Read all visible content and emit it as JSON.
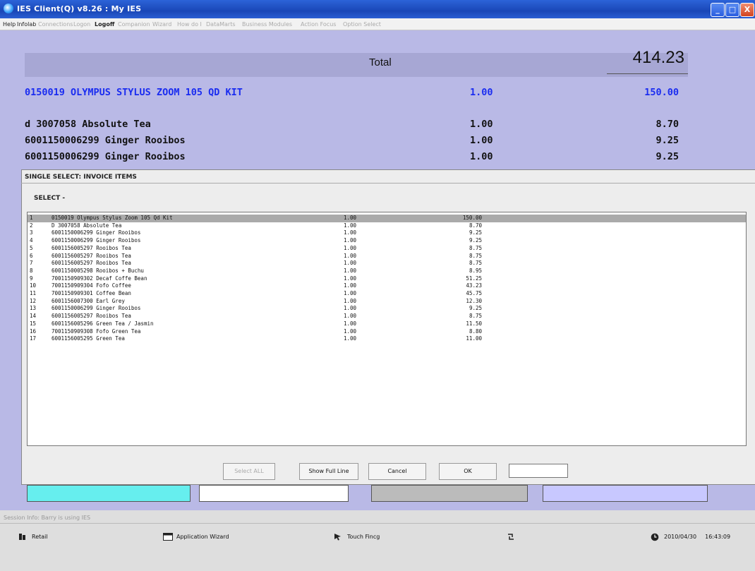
{
  "window": {
    "title": "IES Client(Q) v8.26 : My IES",
    "min": "_",
    "max": "□",
    "close": "X"
  },
  "menu": [
    {
      "label": "Help",
      "state": "on"
    },
    {
      "label": "Infolab",
      "state": "on"
    },
    {
      "label": "Connections",
      "state": "off"
    },
    {
      "label": "Logon",
      "state": "off"
    },
    {
      "label": "Logoff",
      "state": "bold"
    },
    {
      "label": "Companion",
      "state": "off"
    },
    {
      "label": "Wizard",
      "state": "off"
    },
    {
      "label": "How do I",
      "state": "off"
    },
    {
      "label": "DataMarts",
      "state": "off"
    },
    {
      "label": "Business Modules",
      "state": "off"
    },
    {
      "label": "Action Focus",
      "state": "off"
    },
    {
      "label": "Option Select",
      "state": "off"
    }
  ],
  "total": {
    "label": "Total",
    "value": "414.23"
  },
  "lines": [
    {
      "desc": "0150019 OLYMPUS STYLUS ZOOM 105 QD KIT",
      "qty": "1.00",
      "amt": "150.00",
      "highlight": true
    },
    {
      "desc": "d 3007058 Absolute Tea",
      "qty": "1.00",
      "amt": "8.70",
      "highlight": false
    },
    {
      "desc": "6001150006299 Ginger Rooibos",
      "qty": "1.00",
      "amt": "9.25",
      "highlight": false
    },
    {
      "desc": "6001150006299 Ginger Rooibos",
      "qty": "1.00",
      "amt": "9.25",
      "highlight": false
    }
  ],
  "dialog": {
    "title": "SINGLE SELECT: INVOICE ITEMS",
    "select_label": "SELECT -",
    "items": [
      {
        "no": "1",
        "desc": "0150019 Olympus Stylus Zoom 105 Qd Kit",
        "qty": "1.00",
        "amt": "150.00"
      },
      {
        "no": "2",
        "desc": "D 3007058 Absolute Tea",
        "qty": "1.00",
        "amt": "8.70"
      },
      {
        "no": "3",
        "desc": "6001150006299 Ginger Rooibos",
        "qty": "1.00",
        "amt": "9.25"
      },
      {
        "no": "4",
        "desc": "6001150006299 Ginger Rooibos",
        "qty": "1.00",
        "amt": "9.25"
      },
      {
        "no": "5",
        "desc": "6001156005297 Rooibos Tea",
        "qty": "1.00",
        "amt": "8.75"
      },
      {
        "no": "6",
        "desc": "6001156005297 Rooibos Tea",
        "qty": "1.00",
        "amt": "8.75"
      },
      {
        "no": "7",
        "desc": "6001156005297 Rooibos Tea",
        "qty": "1.00",
        "amt": "8.75"
      },
      {
        "no": "8",
        "desc": "6001150005298 Rooibos + Buchu",
        "qty": "1.00",
        "amt": "8.95"
      },
      {
        "no": "9",
        "desc": "7001150909302 Decaf Coffe Bean",
        "qty": "1.00",
        "amt": "51.25"
      },
      {
        "no": "10",
        "desc": "7001150909304 Fofo Coffee",
        "qty": "1.00",
        "amt": "43.23"
      },
      {
        "no": "11",
        "desc": "7001150909301 Coffee Bean",
        "qty": "1.00",
        "amt": "45.75"
      },
      {
        "no": "12",
        "desc": "6001156007300 Earl Grey",
        "qty": "1.00",
        "amt": "12.30"
      },
      {
        "no": "13",
        "desc": "6001150006299 Ginger Rooibos",
        "qty": "1.00",
        "amt": "9.25"
      },
      {
        "no": "14",
        "desc": "6001156005297 Rooibos Tea",
        "qty": "1.00",
        "amt": "8.75"
      },
      {
        "no": "15",
        "desc": "6001156005296 Green Tea / Jasmin",
        "qty": "1.00",
        "amt": "11.50"
      },
      {
        "no": "16",
        "desc": "7001150909308 Fofo Green Tea",
        "qty": "1.00",
        "amt": "8.80"
      },
      {
        "no": "17",
        "desc": "6001156005295 Green Tea",
        "qty": "1.00",
        "amt": "11.00"
      }
    ],
    "buttons": {
      "select_all": "Select ALL",
      "show_full_line": "Show Full Line",
      "cancel": "Cancel",
      "ok": "OK"
    },
    "input_value": ""
  },
  "strip_colors": [
    "#66eeee",
    "#ffffff",
    "#bbbbbb",
    "#c8c8ff"
  ],
  "status": {
    "session": "Session Info: Barry is using IES",
    "retail": "Retail",
    "app_wizard": "Application Wizard",
    "touch": "Touch Fincg",
    "clock_icon": "clock-icon",
    "date": "2010/04/30",
    "time": "16:43:09"
  },
  "colors": {
    "title_bar": "#1a47b7",
    "main_bg": "#b9b9e6",
    "highlight_text": "#1a2cf0",
    "selected_row": "#aaaaaa"
  }
}
